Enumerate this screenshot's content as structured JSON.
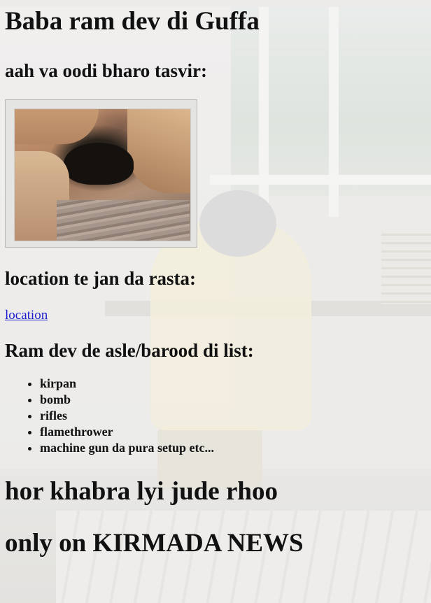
{
  "page": {
    "title": "Baba ram dev di Guffa",
    "photos_heading": "aah va oodi bharo tasvir:",
    "photo_alt": "cave photo",
    "location_heading": "location te jan da rasta:",
    "location_link": "location",
    "list_heading": "Ram dev de asle/barood di list:",
    "weapons": [
      "kirpan",
      "bomb",
      "rifles",
      "flamethrower",
      "machine gun da pura setup etc..."
    ],
    "footer_line1": "hor khabra lyi jude rhoo",
    "footer_line2": "only on KIRMADA NEWS"
  },
  "colors": {
    "link": "#1c1ccc",
    "text": "#111111"
  }
}
